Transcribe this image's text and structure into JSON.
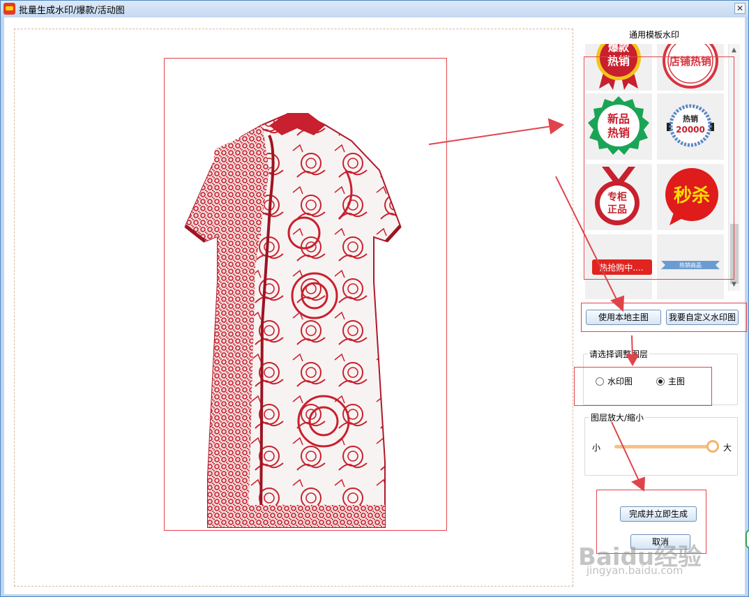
{
  "window": {
    "title": "批量生成水印/爆款/活动图",
    "close_glyph": "✕"
  },
  "templates": {
    "section_title": "通用模板水印",
    "items": [
      {
        "name": "hot-sale-badge-top",
        "line1": "爆款",
        "line2": "热销"
      },
      {
        "name": "store-hot-sale-stamp",
        "text": "店铺热销"
      },
      {
        "name": "new-hot-sale-badge",
        "line1": "新品",
        "line2": "热销"
      },
      {
        "name": "hot-sale-20000-badge",
        "line1": "热销",
        "line2": "20000"
      },
      {
        "name": "genuine-counter-badge",
        "line1": "专柜",
        "line2": "正品"
      },
      {
        "name": "flash-sale-bubble",
        "text": "秒杀"
      },
      {
        "name": "hot-rush-ribbon",
        "text": "热抢购中...."
      },
      {
        "name": "blue-ribbon",
        "text": "热销商品"
      }
    ]
  },
  "buttons": {
    "use_local_main": "使用本地主图",
    "custom_watermark": "我要自定义水印图",
    "finish_generate": "完成并立即生成",
    "cancel": "取消"
  },
  "layer_select": {
    "label": "请选择调整图层",
    "options": [
      {
        "label": "水印图",
        "selected": false
      },
      {
        "label": "主图",
        "selected": true
      }
    ]
  },
  "zoom": {
    "label": "图层放大/缩小",
    "min_label": "小",
    "max_label": "大",
    "value_fraction": 1.0
  },
  "watermark_overlay": {
    "brand": "Baidu经验",
    "url": "jingyan.baidu.com"
  },
  "colors": {
    "annotation_red": "#e0444b",
    "slider_orange": "#f6c183",
    "dress_red": "#c8202e"
  }
}
